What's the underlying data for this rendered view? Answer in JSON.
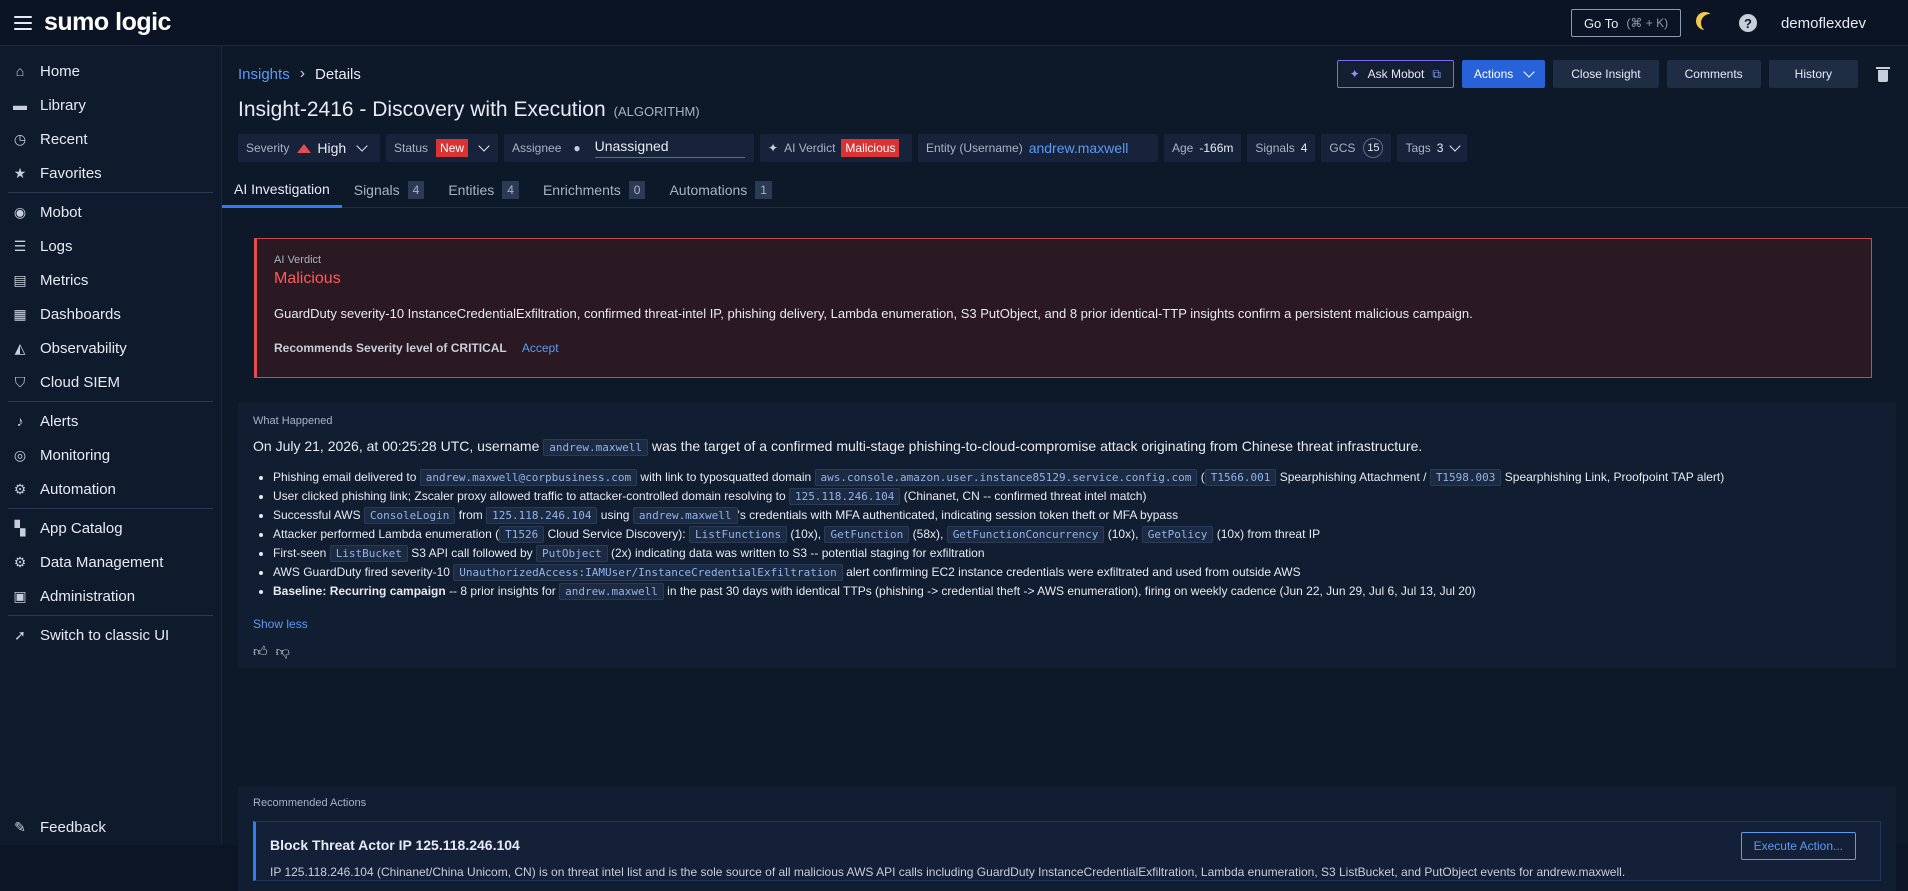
{
  "app": {
    "logo": "sumo logic",
    "user": "demoflexdev"
  },
  "topbar": {
    "goto_label": "Go To",
    "goto_shortcut": "(⌘ + K)"
  },
  "sidebar": {
    "items": [
      {
        "label": "Home",
        "icon": "home-icon"
      },
      {
        "label": "Library",
        "icon": "folder-icon"
      },
      {
        "label": "Recent",
        "icon": "clock-icon"
      },
      {
        "label": "Favorites",
        "icon": "star-icon"
      },
      {
        "label": "Mobot",
        "icon": "robot-icon"
      },
      {
        "label": "Logs",
        "icon": "logs-icon"
      },
      {
        "label": "Metrics",
        "icon": "metrics-icon"
      },
      {
        "label": "Dashboards",
        "icon": "dashboard-icon"
      },
      {
        "label": "Observability",
        "icon": "observability-icon"
      },
      {
        "label": "Cloud SIEM",
        "icon": "shield-icon"
      },
      {
        "label": "Alerts",
        "icon": "bell-icon"
      },
      {
        "label": "Monitoring",
        "icon": "monitoring-icon"
      },
      {
        "label": "Automation",
        "icon": "automation-icon"
      },
      {
        "label": "App Catalog",
        "icon": "grid-icon"
      },
      {
        "label": "Data Management",
        "icon": "gear-icon"
      },
      {
        "label": "Administration",
        "icon": "admin-icon"
      },
      {
        "label": "Switch to classic UI",
        "icon": "rocket-icon"
      }
    ],
    "feedback": "Feedback"
  },
  "breadcrumb": {
    "parent": "Insights",
    "current": "Details"
  },
  "header": {
    "title": "Insight-2416 - Discovery with Execution",
    "algo": "(ALGORITHM)",
    "buttons": {
      "ask_mobot": "Ask Mobot",
      "actions": "Actions",
      "close": "Close Insight",
      "comments": "Comments",
      "history": "History"
    }
  },
  "meta": {
    "severity_label": "Severity",
    "severity": "High",
    "status_label": "Status",
    "status": "New",
    "assignee_label": "Assignee",
    "assignee": "Unassigned",
    "verdict_label": "AI Verdict",
    "verdict": "Malicious",
    "entity_label": "Entity (Username)",
    "entity": "andrew.maxwell",
    "age_label": "Age",
    "age": "-166m",
    "signals_label": "Signals",
    "signals": "4",
    "gcs_label": "GCS",
    "gcs": "15",
    "tags_label": "Tags",
    "tags": "3"
  },
  "tabs": [
    {
      "label": "AI Investigation",
      "count": ""
    },
    {
      "label": "Signals",
      "count": "4"
    },
    {
      "label": "Entities",
      "count": "4"
    },
    {
      "label": "Enrichments",
      "count": "0"
    },
    {
      "label": "Automations",
      "count": "1"
    }
  ],
  "verdict_card": {
    "label": "AI Verdict",
    "value": "Malicious",
    "description": "GuardDuty severity-10 InstanceCredentialExfiltration, confirmed threat-intel IP, phishing delivery, Lambda enumeration, S3 PutObject, and 8 prior identical-TTP insights confirm a persistent malicious campaign.",
    "recommendation": "Recommends Severity level of CRITICAL",
    "accept": "Accept"
  },
  "what_happened": {
    "label": "What Happened",
    "lead_1": "On July 21, 2026, at 00:25:28 UTC, username",
    "lead_code": "andrew.maxwell",
    "lead_2": "was the target of a confirmed multi-stage phishing-to-cloud-compromise attack originating from Chinese threat infrastructure.",
    "bullets": {
      "b1": {
        "t1": "Phishing email delivered to",
        "c1": "andrew.maxwell@corpbusiness.com",
        "t2": "with link to typosquatted domain",
        "c2": "aws.console.amazon.user.instance85129.service.config.com",
        "t3": "(",
        "c3": "T1566.001",
        "t4": "Spearphishing Attachment /",
        "c4": "T1598.003",
        "t5": "Spearphishing Link, Proofpoint TAP alert)"
      },
      "b2": {
        "t1": "User clicked phishing link; Zscaler proxy allowed traffic to attacker-controlled domain resolving to",
        "c1": "125.118.246.104",
        "t2": "(Chinanet, CN -- confirmed threat intel match)"
      },
      "b3": {
        "t1": "Successful AWS",
        "c1": "ConsoleLogin",
        "t2": "from",
        "c2": "125.118.246.104",
        "t3": "using",
        "c3": "andrew.maxwell",
        "t4": "'s credentials with MFA authenticated, indicating session token theft or MFA bypass"
      },
      "b4": {
        "t1": "Attacker performed Lambda enumeration (",
        "c1": "T1526",
        "t2": "Cloud Service Discovery):",
        "c2": "ListFunctions",
        "t3": "(10x),",
        "c3": "GetFunction",
        "t4": "(58x),",
        "c4": "GetFunctionConcurrency",
        "t5": "(10x),",
        "c5": "GetPolicy",
        "t6": "(10x) from threat IP"
      },
      "b5": {
        "t1": "First-seen",
        "c1": "ListBucket",
        "t2": "S3 API call followed by",
        "c2": "PutObject",
        "t3": "(2x) indicating data was written to S3 -- potential staging for exfiltration"
      },
      "b6": {
        "t1": "AWS GuardDuty fired severity-10",
        "c1": "UnauthorizedAccess:IAMUser/InstanceCredentialExfiltration",
        "t2": "alert confirming EC2 instance credentials were exfiltrated and used from outside AWS"
      },
      "b7": {
        "bold": "Baseline: Recurring campaign",
        "t1": "-- 8 prior insights for",
        "c1": "andrew.maxwell",
        "t2": "in the past 30 days with identical TTPs (phishing -> credential theft -> AWS enumeration), firing on weekly cadence (Jun 22, Jun 29, Jul 6, Jul 13, Jul 20)"
      }
    },
    "show_less": "Show less"
  },
  "recommended": {
    "label": "Recommended Actions",
    "title": "Block Threat Actor IP 125.118.246.104",
    "desc": "IP 125.118.246.104 (Chinanet/China Unicom, CN) is on threat intel list and is the sole source of all malicious AWS API calls including GuardDuty InstanceCredentialExfiltration, Lambda enumeration, S3 ListBucket, and PutObject events for andrew.maxwell.",
    "execute": "Execute Action..."
  },
  "colors": {
    "accent": "#2f7df6",
    "danger": "#e34d4d",
    "link": "#5b9bf3",
    "background": "#0d1829"
  }
}
